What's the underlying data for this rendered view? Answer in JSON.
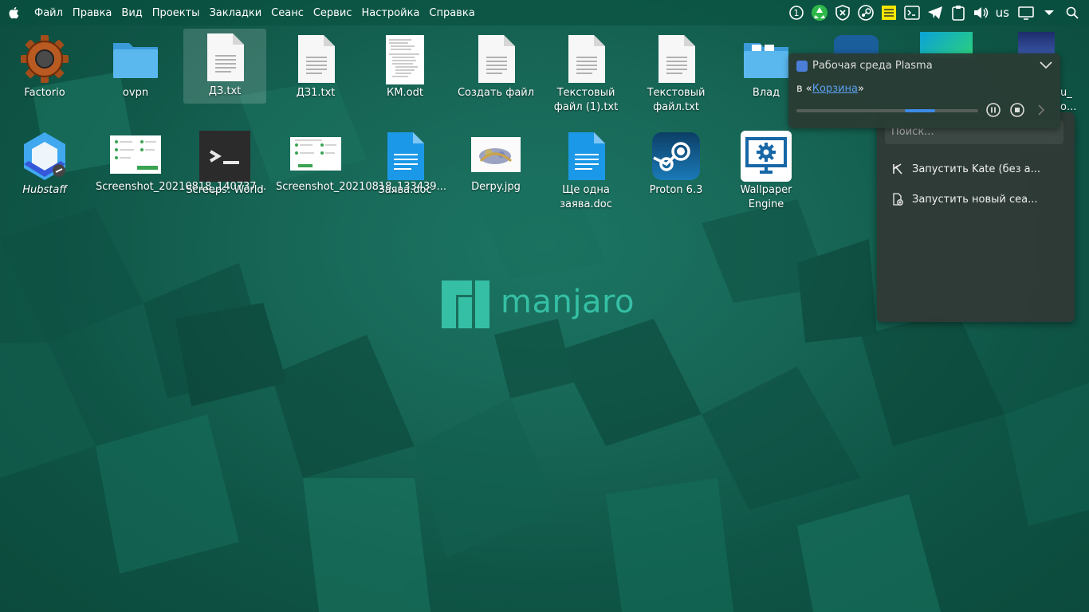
{
  "menubar": {
    "items": [
      "Файл",
      "Правка",
      "Вид",
      "Проекты",
      "Закладки",
      "Сеанс",
      "Сервис",
      "Настройка",
      "Справка"
    ],
    "tray": {
      "badge_number": "1",
      "keyboard_layout": "us"
    }
  },
  "desktop": {
    "icons": [
      {
        "label": "Factorio",
        "icon": "factorio-gear-icon"
      },
      {
        "label": "ovpn",
        "icon": "folder-icon"
      },
      {
        "label": "ДЗ.txt",
        "icon": "text-file-icon",
        "selected": true
      },
      {
        "label": "ДЗ1.txt",
        "icon": "text-file-icon"
      },
      {
        "label": "КМ.odt",
        "icon": "document-preview-icon"
      },
      {
        "label": "Создать файл",
        "icon": "text-file-icon"
      },
      {
        "label": "Текстовый файл (1).txt",
        "icon": "text-file-icon"
      },
      {
        "label": "Текстовый файл.txt",
        "icon": "text-file-icon"
      },
      {
        "label": "Влад",
        "icon": "folder-icon"
      },
      {
        "label": "Hubstaff",
        "icon": "hubstaff-icon",
        "italic": true
      },
      {
        "label": "Screenshot_20210818_140737...",
        "icon": "screenshot-preview-icon"
      },
      {
        "label": "Screeps: World",
        "icon": "terminal-icon"
      },
      {
        "label": "Screenshot_20210818_133439...",
        "icon": "screenshot-preview-icon"
      },
      {
        "label": "Заява.doc",
        "icon": "document-icon"
      },
      {
        "label": "Derpy.jpg",
        "icon": "image-preview-icon"
      },
      {
        "label": "Ще одна заява.doc",
        "icon": "document-icon"
      },
      {
        "label": "Proton 6.3",
        "icon": "steam-icon"
      },
      {
        "label": "Wallpaper Engine",
        "icon": "wallpaper-engine-icon"
      }
    ],
    "partial_icons": [
      "u_",
      "о..."
    ]
  },
  "notification": {
    "app": "Рабочая среда Plasma",
    "body_prefix": "в «",
    "link": "Корзина",
    "body_suffix": "»",
    "progress": 0.67
  },
  "launcher": {
    "search_placeholder": "Поиск...",
    "items": [
      "Запустить Kate (без а...",
      "Запустить новый сеа..."
    ]
  },
  "logo": {
    "text": "manjaro"
  },
  "colors": {
    "accent": "#35bfa4",
    "link": "#5aa0f0",
    "progress": "#3d8ae6"
  }
}
